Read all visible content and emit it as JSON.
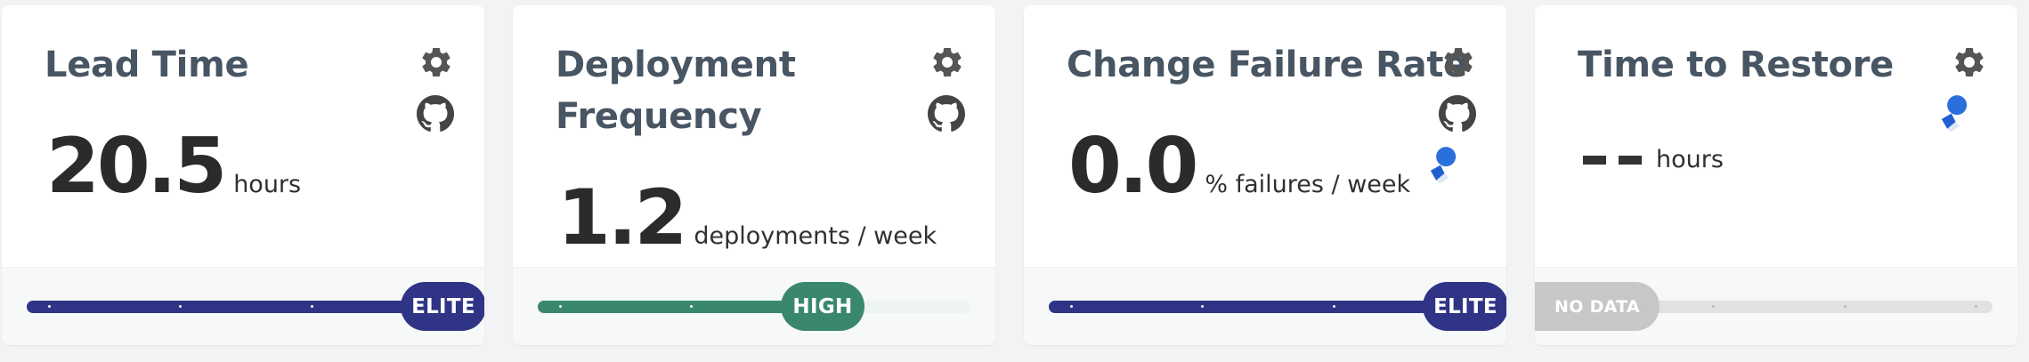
{
  "colors": {
    "elite": "#2f3486",
    "high": "#3a8770",
    "nodata": "#c7c7c7",
    "title": "#485563",
    "icon": "#555555"
  },
  "cards": [
    {
      "title": "Lead Time",
      "value": "20.5",
      "unit": "hours",
      "badge": "ELITE",
      "icons": [
        "gear-icon",
        "github-icon"
      ],
      "level": 1.0
    },
    {
      "title": "Deployment Frequency",
      "value": "1.2",
      "unit": "deployments / week",
      "badge": "HIGH",
      "icons": [
        "gear-icon",
        "github-icon"
      ],
      "level": 0.75
    },
    {
      "title": "Change Failure Rate",
      "value": "0.0",
      "unit": "% failures / week",
      "badge": "ELITE",
      "icons": [
        "gear-icon",
        "github-icon",
        "jira-icon"
      ],
      "level": 1.0
    },
    {
      "title": "Time to Restore",
      "value": "--",
      "unit": "hours",
      "badge": "NO DATA",
      "icons": [
        "gear-icon",
        "jira-icon"
      ],
      "level": 0.0
    }
  ]
}
